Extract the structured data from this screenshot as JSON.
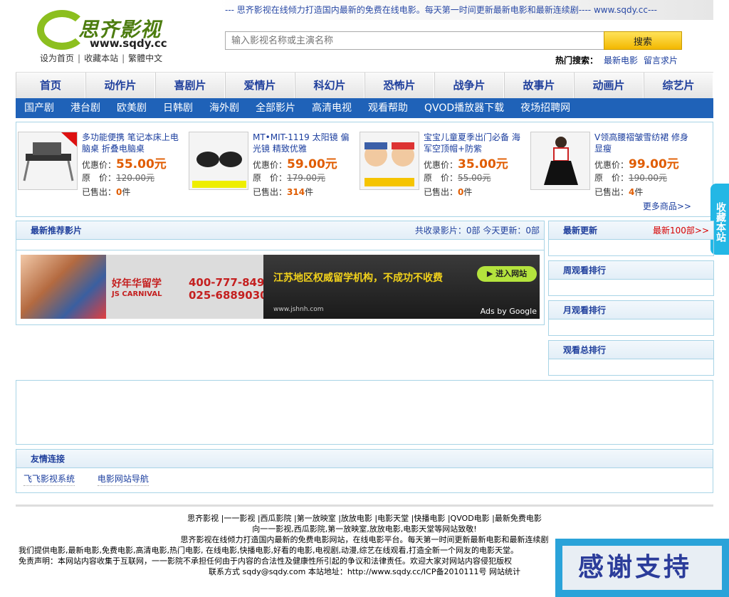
{
  "header": {
    "tagline": "--- 思齐影视在线倾力打造国内最新的免费在线电影。每天第一时间更新最新电影和最新连续剧---- www.sqdy.cc---",
    "logo_cn": "思齐影视",
    "logo_en": "www.sqdy.cc",
    "links": [
      "设为首页",
      "收藏本站",
      "繁體中文"
    ],
    "search_placeholder": "输入影视名称或主演名称",
    "search_button": "搜索",
    "hot_label": "热门搜索：",
    "hot_links": [
      "最新电影",
      "留言求片"
    ]
  },
  "nav_main": [
    "首页",
    "动作片",
    "喜剧片",
    "爱情片",
    "科幻片",
    "恐怖片",
    "战争片",
    "故事片",
    "动画片",
    "综艺片"
  ],
  "nav_sub": [
    "国产剧",
    "港台剧",
    "欧美剧",
    "日韩剧",
    "海外剧",
    "全部影片",
    "高清电视",
    "观看帮助",
    "QVOD播放器下载",
    "夜场招聘网"
  ],
  "products": [
    {
      "title": "多功能便携 笔记本床上电脑桌 折叠电脑桌",
      "price_label": "优惠价：",
      "price": "55.00元",
      "orig_label": "原　价：",
      "orig": "120.00元",
      "sold_label": "已售出：",
      "sold": "0",
      "unit": "件",
      "icon": "laptop-desk-icon"
    },
    {
      "title": "MT•MIT-1119 太阳镜 偏光镜 精致优雅",
      "price_label": "优惠价：",
      "price": "59.00元",
      "orig_label": "原　价：",
      "orig": "179.00元",
      "sold_label": "已售出：",
      "sold": "314",
      "unit": "件",
      "icon": "sunglasses-icon"
    },
    {
      "title": "宝宝儿童夏季出门必备 海军空顶帽+防紫",
      "price_label": "优惠价：",
      "price": "35.00元",
      "orig_label": "原　价：",
      "orig": "55.00元",
      "sold_label": "已售出：",
      "sold": "0",
      "unit": "件",
      "icon": "kids-hat-icon"
    },
    {
      "title": "V领高腰褶皱雪纺裙 修身显瘦",
      "price_label": "优惠价：",
      "price": "99.00元",
      "orig_label": "原　价：",
      "orig": "190.00元",
      "sold_label": "已售出：",
      "sold": "4",
      "unit": "件",
      "icon": "dress-icon"
    }
  ],
  "more_products": "更多商品>>",
  "side_tab": "收藏本站",
  "recommend": {
    "title": "最新推荐影片",
    "stats": "共收录影片：0部  今天更新：0部"
  },
  "ad": {
    "brand": "好年华留学",
    "brand_en": "JS CARNIVAL",
    "phone1": "400-777-8498",
    "phone2": "025-68890300",
    "slogan": "江苏地区权威留学机构，不成功不收费",
    "enter": "进入网站",
    "url": "www.jshnh.com",
    "ads_by": "Ads by Google"
  },
  "sidebar": {
    "latest": "最新更新",
    "latest_more": "最新100部>>",
    "week": "周观看排行",
    "month": "月观看排行",
    "total": "观看总排行"
  },
  "friend": {
    "title": "友情连接",
    "links": [
      "飞飞影视系统",
      "电影网站导航"
    ]
  },
  "footer": {
    "line1": "思齐影视 |一一影视 |西瓜影院 |第一放映室 |放放电影 |电影天堂 |快播电影 |QVOD电影 |最新免费电影",
    "line2": "向一一影视,西瓜影院,第一放映室,放放电影,电影天堂等网站致敬!",
    "line3": "思齐影视在线倾力打造国内最新的免费电影网站，在线电影平台。每天第一时间更新最新电影和最新连续剧",
    "line4": "我们提供电影,最新电影,免费电影,高清电影,热门电影, 在线电影,快播电影,好看的电影,电视剧,动漫,综艺在线观看,打造全新一个网友的电影天堂。",
    "line5": "免责声明：本网站内容收集于互联网，一一影院不承担任何由于内容的合法性及健康性所引起的争议和法律责任。欢迎大家对网站内容侵犯版权",
    "line6": "联系方式  sqdy@sqdy.com 本站地址：http://www.sqdy.cc/ICP备2010111号 网站统计"
  },
  "thanks": "感谢支持"
}
